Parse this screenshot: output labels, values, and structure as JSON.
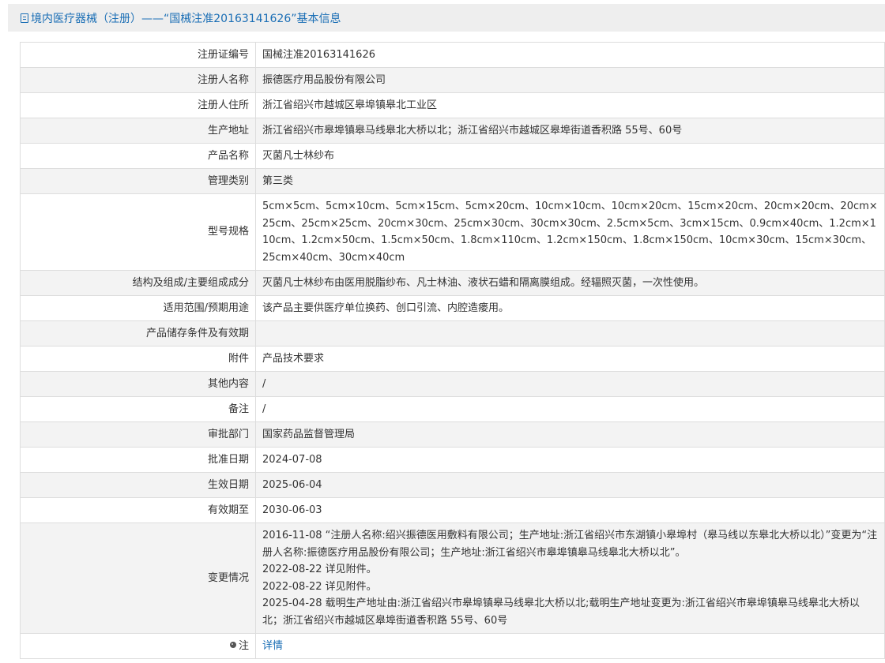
{
  "header": {
    "title": "境内医疗器械（注册）——“国械注准20163141626”基本信息",
    "icon": "document-icon"
  },
  "rows": [
    {
      "label": "注册证编号",
      "value": "国械注准20163141626"
    },
    {
      "label": "注册人名称",
      "value": "振德医疗用品股份有限公司"
    },
    {
      "label": "注册人住所",
      "value": "浙江省绍兴市越城区皋埠镇皋北工业区"
    },
    {
      "label": "生产地址",
      "value": "浙江省绍兴市皋埠镇皋马线皋北大桥以北；浙江省绍兴市越城区皋埠街道香积路 55号、60号"
    },
    {
      "label": "产品名称",
      "value": "灭菌凡士林纱布"
    },
    {
      "label": "管理类别",
      "value": "第三类"
    },
    {
      "label": "型号规格",
      "value": "5cm×5cm、5cm×10cm、5cm×15cm、5cm×20cm、10cm×10cm、10cm×20cm、15cm×20cm、20cm×20cm、20cm×25cm、25cm×25cm、20cm×30cm、25cm×30cm、30cm×30cm、2.5cm×5cm、3cm×15cm、0.9cm×40cm、1.2cm×110cm、1.2cm×50cm、1.5cm×50cm、1.8cm×110cm、1.2cm×150cm、1.8cm×150cm、10cm×30cm、15cm×30cm、25cm×40cm、30cm×40cm"
    },
    {
      "label": "结构及组成/主要组成成分",
      "value": "灭菌凡士林纱布由医用脱脂纱布、凡士林油、液状石蜡和隔离膜组成。经辐照灭菌，一次性使用。"
    },
    {
      "label": "适用范围/预期用途",
      "value": "该产品主要供医疗单位换药、创口引流、内腔造瘘用。"
    },
    {
      "label": "产品储存条件及有效期",
      "value": ""
    },
    {
      "label": "附件",
      "value": "产品技术要求"
    },
    {
      "label": "其他内容",
      "value": "/"
    },
    {
      "label": "备注",
      "value": "/"
    },
    {
      "label": "审批部门",
      "value": "国家药品监督管理局"
    },
    {
      "label": "批准日期",
      "value": "2024-07-08"
    },
    {
      "label": "生效日期",
      "value": "2025-06-04"
    },
    {
      "label": "有效期至",
      "value": "2030-06-03"
    }
  ],
  "changes": {
    "label": "变更情况",
    "lines": [
      "2016-11-08 “注册人名称:绍兴振德医用敷料有限公司；生产地址:浙江省绍兴市东湖镇小皋埠村（皋马线以东皋北大桥以北）”变更为“注册人名称:振德医疗用品股份有限公司；生产地址:浙江省绍兴市皋埠镇皋马线皋北大桥以北”。",
      "2022-08-22 详见附件。",
      "2022-08-22 详见附件。",
      "2025-04-28 载明生产地址由:浙江省绍兴市皋埠镇皋马线皋北大桥以北;载明生产地址变更为:浙江省绍兴市皋埠镇皋马线皋北大桥以北；浙江省绍兴市越城区皋埠街道香积路 55号、60号"
    ]
  },
  "note": {
    "label": "注",
    "icon": "location-pin-icon",
    "link_text": "详情"
  },
  "colors": {
    "accent": "#1a6eb5",
    "header_bg": "#eeeeee",
    "stripe_bg": "#f3f3f3",
    "border": "#dddddd"
  }
}
